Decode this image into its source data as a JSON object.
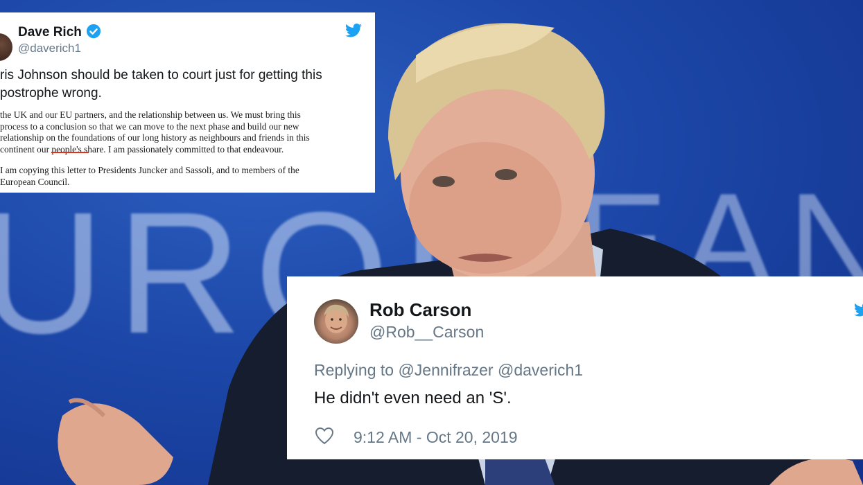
{
  "tweet_top": {
    "name": "Dave Rich",
    "handle": "@daverich1",
    "text": "ris Johnson should be taken to court just for getting this\npostrophe wrong.",
    "letter_paragraph_1": " the UK and our EU partners, and the relationship between us. We must bring this\n process to a conclusion so that we can move to the next phase and build our new\n relationship on the foundations of our long history as neighbours and friends in this\n continent our people's share.  I am passionately committed to that endeavour.",
    "letter_paragraph_2": " I am copying this letter to Presidents Juncker and Sassoli, and to members of the\n European Council.",
    "icons": [
      "avatar",
      "verified-badge-icon",
      "twitter-bird-icon"
    ]
  },
  "tweet_bottom": {
    "name": "Rob Carson",
    "handle": "@Rob__Carson",
    "reply_to": "Replying to @Jennifrazer @daverich1",
    "text": "He didn't even need an 'S'.",
    "timestamp": "9:12 AM - Oct 20, 2019",
    "icons": [
      "avatar",
      "heart-icon",
      "twitter-bird-icon"
    ]
  },
  "background": {
    "word_left": "UROP",
    "word_right": "EAN"
  },
  "colors": {
    "twitter_blue": "#1da1f2",
    "background_blue": "#1c47a8",
    "underline_red": "#e0301e"
  }
}
